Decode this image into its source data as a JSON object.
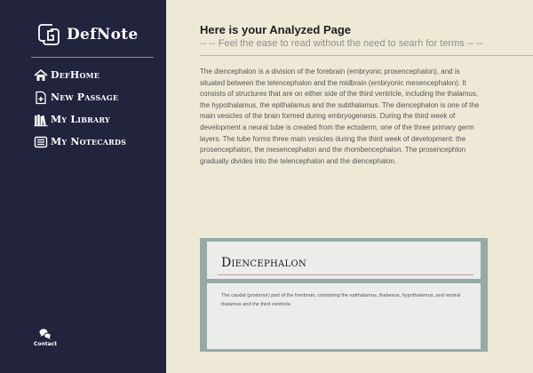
{
  "app": {
    "name": "DefNote"
  },
  "nav": {
    "items": [
      {
        "icon": "home-icon",
        "label": "DefHome"
      },
      {
        "icon": "new-passage-icon",
        "label": "New Passage"
      },
      {
        "icon": "library-icon",
        "label": "My Library"
      },
      {
        "icon": "notecards-icon",
        "label": "My Notecards"
      }
    ]
  },
  "contact": {
    "label": "Contact",
    "icon": "chat-icon"
  },
  "header": {
    "title": "Here is your Analyzed Page",
    "subtitle": "-- -- Feel the ease to read without the need to searh for terms -- --"
  },
  "passage": {
    "text": "The diencephalon is a division of the forebrain (embryonic prosencephalon), and is situated between the telencephalon and the midbrain (embryonic mesencephalon). It consists of structures that are on either side of the third ventricle, including the thalamus, the hypothalamus, the epithalamus and the subthalamus. The diencephalon is one of the main vesicles of the brain formed during embryogenesis. During the third week of development a neural tube is created from the ectoderm, one of the three primary germ layers. The tube forms three main vesicles during the third week of development: the prosencephalon, the mesencephalon and the rhombencephalon. The prosencephlon gradually divides into the telencephalon and the diencephalon."
  },
  "definition_card": {
    "term": "Diencephalon",
    "definition": "The caudal (posterior) part of the forebrain, containing the epithalamus, thalamus, hypothalamus, and ventral thalamus and the third ventricle."
  },
  "colors": {
    "sidebar": "#22233d",
    "page_background": "#ede9d6",
    "card_frame": "#95aaa6",
    "card_panel": "#ececea",
    "card_rule": "#c79a98"
  }
}
